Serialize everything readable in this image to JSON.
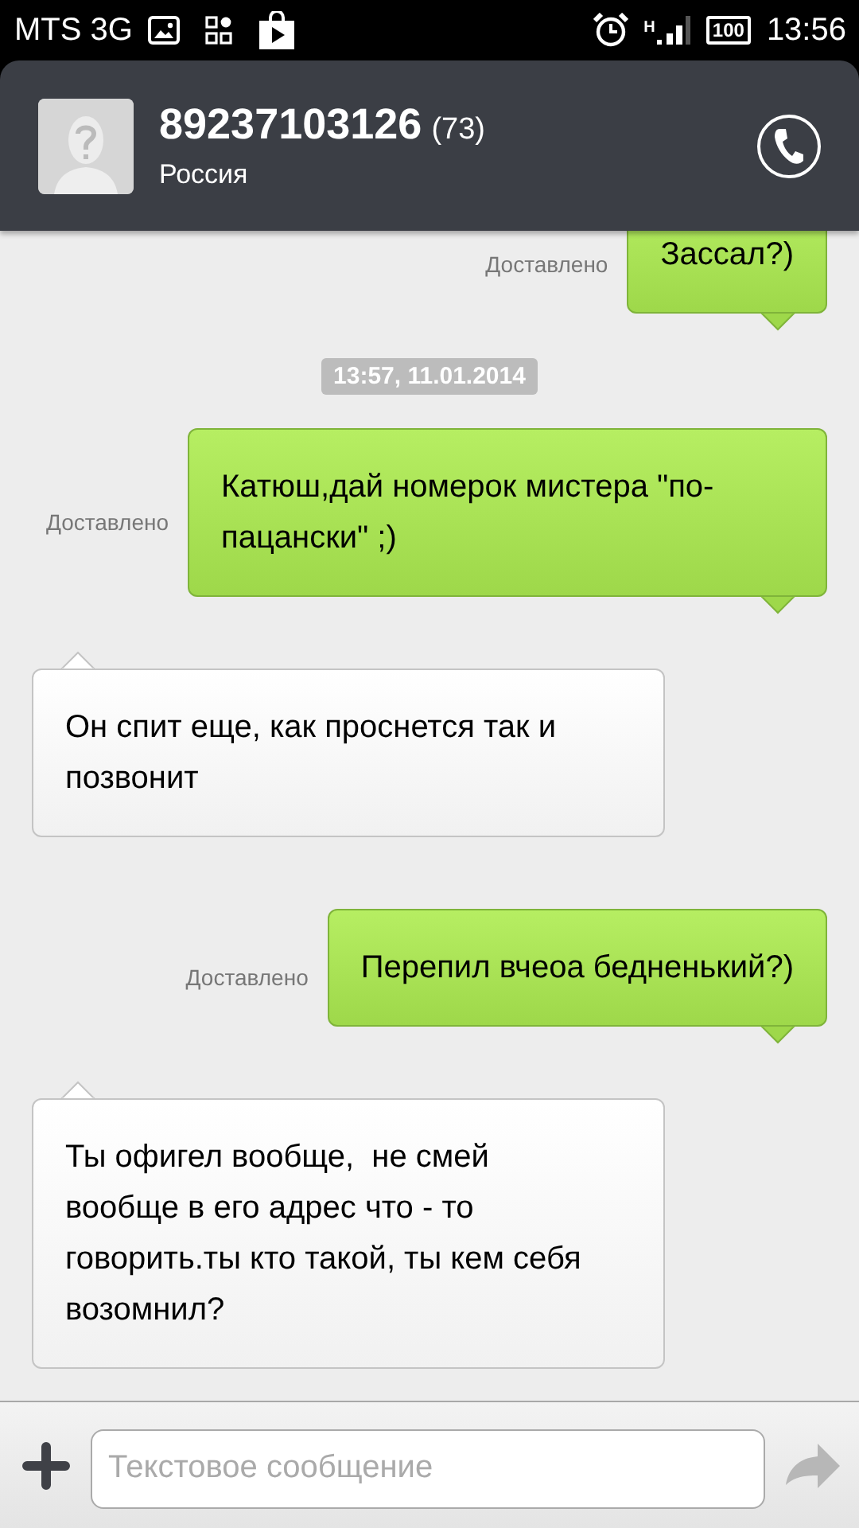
{
  "status_bar": {
    "carrier": "MTS 3G",
    "network_type": "H",
    "battery": "100",
    "time": "13:56"
  },
  "header": {
    "contact": "89237103126",
    "count": "(73)",
    "region": "Россия"
  },
  "messages": [
    {
      "kind": "outgoing",
      "text": "Зассал?)",
      "status": "Доставлено"
    },
    {
      "kind": "timestamp",
      "text": "13:57, 11.01.2014"
    },
    {
      "kind": "outgoing",
      "text": "Катюш,дай номерок мистера \"по-пацански\" ;)",
      "status": "Доставлено"
    },
    {
      "kind": "incoming",
      "text": "Он спит еще, как проснется так и позвонит"
    },
    {
      "kind": "outgoing",
      "text": "Перепил вчеоа бедненький?)",
      "status": "Доставлено"
    },
    {
      "kind": "incoming",
      "text": "Ты офигел вообще,  не смей вообще в его адрес что - то говорить.ты кто такой, ты кем себя возомнил?"
    }
  ],
  "compose": {
    "placeholder": "Текстовое сообщение"
  }
}
